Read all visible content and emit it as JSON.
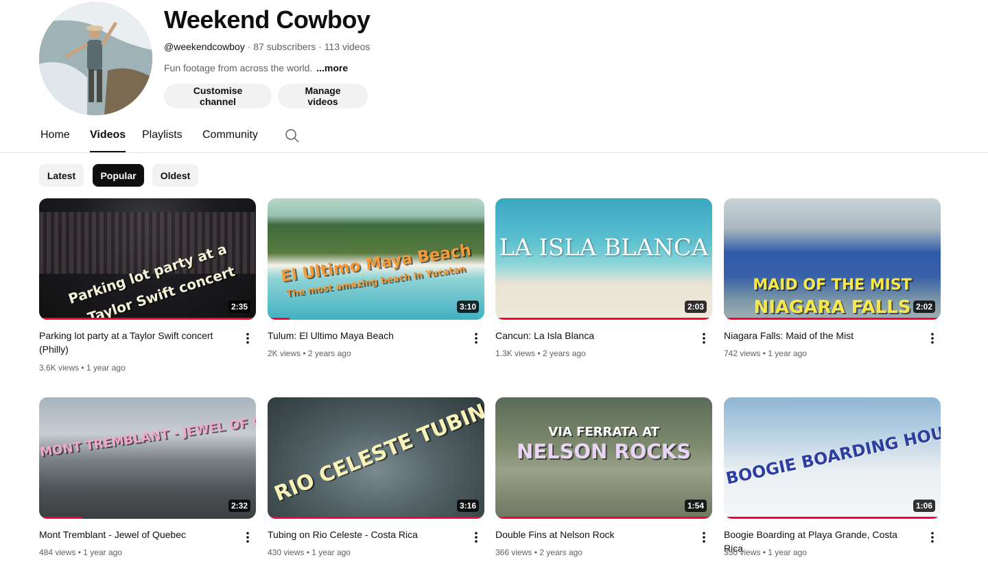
{
  "channel": {
    "name": "Weekend Cowboy",
    "handle": "@weekendcowboy",
    "subscribers": "87 subscribers",
    "video_count": "113 videos",
    "meta_separator": "·",
    "description": "Fun footage from across the world.",
    "more_label": "...more",
    "customise_label": "Customise channel",
    "manage_label": "Manage videos"
  },
  "tabs": [
    {
      "label": "Home",
      "active": false
    },
    {
      "label": "Videos",
      "active": true
    },
    {
      "label": "Playlists",
      "active": false
    },
    {
      "label": "Community",
      "active": false
    }
  ],
  "icons": {
    "search": "search-icon",
    "more": "more-vert-icon"
  },
  "filters": [
    {
      "label": "Latest",
      "selected": false
    },
    {
      "label": "Popular",
      "selected": true
    },
    {
      "label": "Oldest",
      "selected": false
    }
  ],
  "meta_dot": "•",
  "videos": [
    {
      "title": "Parking lot party at a Taylor Swift concert (Philly)",
      "views": "3.6K views",
      "age": "1 year ago",
      "duration": "2:35",
      "thumb_text": [
        "Parking lot party at a",
        "Taylor Swift concert"
      ],
      "watched": 1.0
    },
    {
      "title": "Tulum: El Ultimo Maya Beach",
      "views": "2K views",
      "age": "2 years ago",
      "duration": "3:10",
      "thumb_text": [
        "El Ultimo Maya Beach",
        "The most amazing beach in Yucatan"
      ],
      "watched": 0.1
    },
    {
      "title": "Cancun: La Isla Blanca",
      "views": "1.3K views",
      "age": "2 years ago",
      "duration": "2:03",
      "thumb_text": [
        "LA ISLA BLANCA"
      ],
      "watched": 1.0
    },
    {
      "title": "Niagara Falls: Maid of the Mist",
      "views": "742 views",
      "age": "1 year ago",
      "duration": "2:02",
      "thumb_text": [
        "MAID OF THE MIST",
        "NIAGARA FALLS"
      ],
      "watched": 1.0
    },
    {
      "title": "Mont Tremblant - Jewel of Quebec",
      "views": "484 views",
      "age": "1 year ago",
      "duration": "2:32",
      "thumb_text": [
        "MONT TREMBLANT - JEWEL OF QUEBEC"
      ],
      "watched": 0.2
    },
    {
      "title": "Tubing on Rio Celeste - Costa Rica",
      "views": "430 views",
      "age": "1 year ago",
      "duration": "3:16",
      "thumb_text": [
        "RIO CELESTE TUBING"
      ],
      "watched": 1.0
    },
    {
      "title": "Double Fins at Nelson Rock",
      "views": "366 views",
      "age": "2 years ago",
      "duration": "1:54",
      "thumb_text": [
        "VIA FERRATA AT",
        "NELSON ROCKS"
      ],
      "watched": 1.0
    },
    {
      "title": "Boogie Boarding at Playa Grande, Costa Rica",
      "views": "350 views",
      "age": "1 year ago",
      "duration": "1:06",
      "thumb_text": [
        "BOOGIE BOARDING HOUR"
      ],
      "watched": 1.0
    }
  ]
}
